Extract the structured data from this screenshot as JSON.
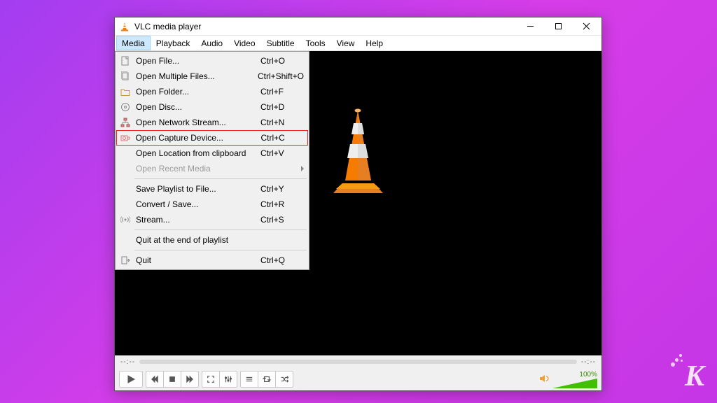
{
  "window": {
    "title": "VLC media player"
  },
  "menubar": {
    "items": [
      {
        "label": "Media",
        "active": true
      },
      {
        "label": "Playback"
      },
      {
        "label": "Audio"
      },
      {
        "label": "Video"
      },
      {
        "label": "Subtitle"
      },
      {
        "label": "Tools"
      },
      {
        "label": "View"
      },
      {
        "label": "Help"
      }
    ]
  },
  "media_menu": {
    "groups": [
      [
        {
          "icon": "file",
          "label": "Open File...",
          "shortcut": "Ctrl+O"
        },
        {
          "icon": "files",
          "label": "Open Multiple Files...",
          "shortcut": "Ctrl+Shift+O"
        },
        {
          "icon": "folder",
          "label": "Open Folder...",
          "shortcut": "Ctrl+F"
        },
        {
          "icon": "disc",
          "label": "Open Disc...",
          "shortcut": "Ctrl+D"
        },
        {
          "icon": "network",
          "label": "Open Network Stream...",
          "shortcut": "Ctrl+N"
        },
        {
          "icon": "capture",
          "label": "Open Capture Device...",
          "shortcut": "Ctrl+C",
          "highlighted": true
        },
        {
          "icon": "",
          "label": "Open Location from clipboard",
          "shortcut": "Ctrl+V"
        },
        {
          "icon": "",
          "label": "Open Recent Media",
          "shortcut": "",
          "disabled": true,
          "submenu": true
        }
      ],
      [
        {
          "icon": "",
          "label": "Save Playlist to File...",
          "shortcut": "Ctrl+Y"
        },
        {
          "icon": "",
          "label": "Convert / Save...",
          "shortcut": "Ctrl+R"
        },
        {
          "icon": "stream",
          "label": "Stream...",
          "shortcut": "Ctrl+S"
        }
      ],
      [
        {
          "icon": "",
          "label": "Quit at the end of playlist",
          "shortcut": ""
        }
      ],
      [
        {
          "icon": "quit",
          "label": "Quit",
          "shortcut": "Ctrl+Q"
        }
      ]
    ]
  },
  "playback": {
    "time_start": "--:--",
    "time_end": "--:--",
    "volume_percent": "100%"
  },
  "branding": {
    "logo_letter": "K"
  }
}
